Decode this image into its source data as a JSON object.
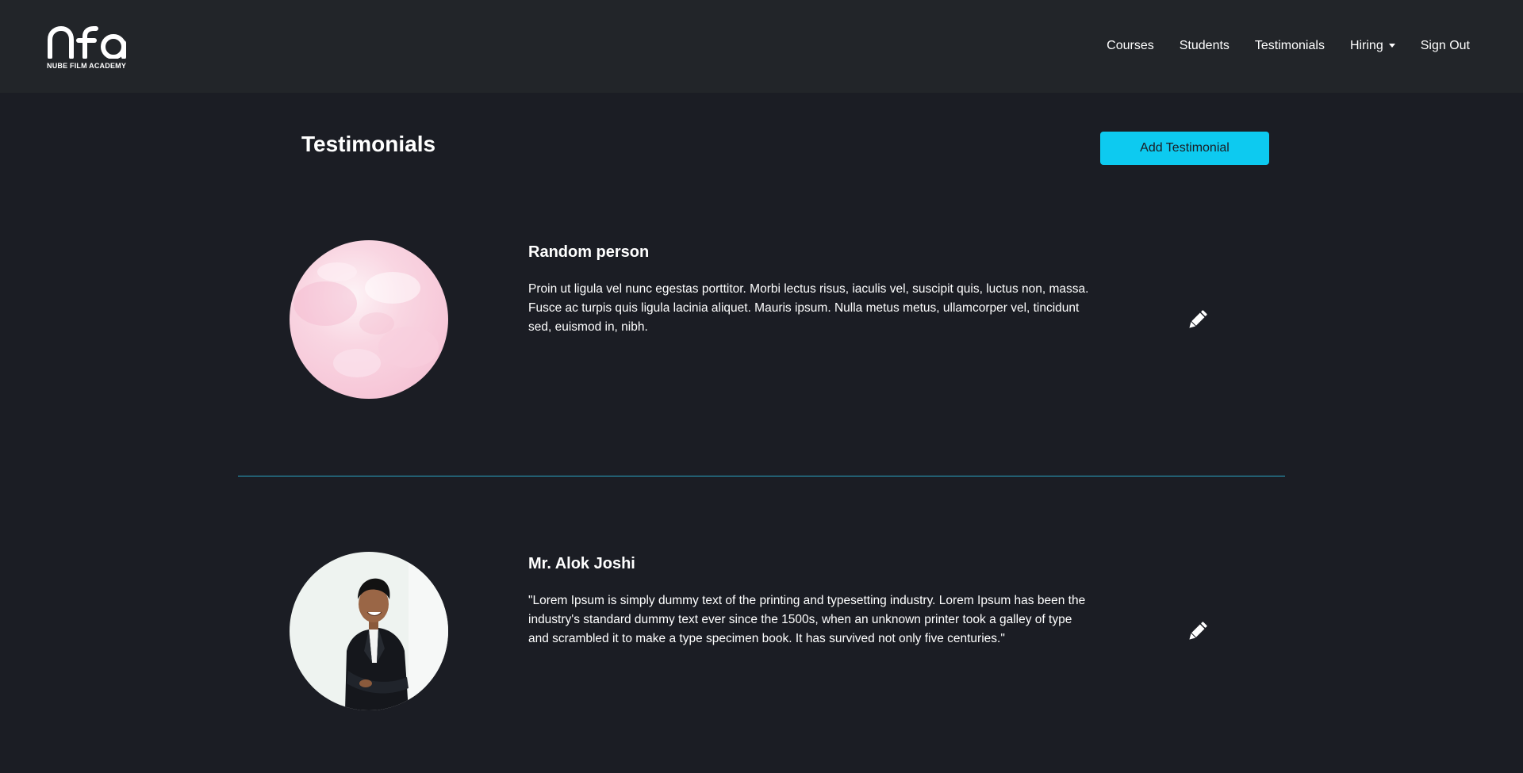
{
  "brand": {
    "logo_text": "nfa",
    "name": "NUBE FILM ACADEMY"
  },
  "nav": {
    "items": [
      "Courses",
      "Students",
      "Testimonials",
      "Hiring",
      "Sign Out"
    ]
  },
  "page": {
    "title": "Testimonials",
    "add_button_label": "Add Testimonial"
  },
  "testimonials": [
    {
      "name": "Random person",
      "text": "Proin ut ligula vel nunc egestas porttitor. Morbi lectus risus, iaculis vel, suscipit quis, luctus non, massa. Fusce ac turpis quis ligula lacinia aliquet. Mauris ipsum. Nulla metus metus, ullamcorper vel, tincidunt sed, euismod in, nibh.",
      "avatar": "pink-watercolor-image"
    },
    {
      "name": "Mr. Alok Joshi",
      "text": "\"Lorem Ipsum is simply dummy text of the printing and typesetting industry. Lorem Ipsum has been the industry's standard dummy text ever since the 1500s, when an unknown printer took a galley of type and scrambled it to make a type specimen book. It has survived not only five centuries.\"",
      "avatar": "man-in-suit-photo"
    }
  ],
  "icons": {
    "edit": "pencil-icon",
    "dropdown": "caret-down-icon"
  },
  "colors": {
    "background": "#1b1d24",
    "navbar": "#222529",
    "accent": "#0dcaf0",
    "divider": "#2aa5c4",
    "text": "#ffffff"
  }
}
